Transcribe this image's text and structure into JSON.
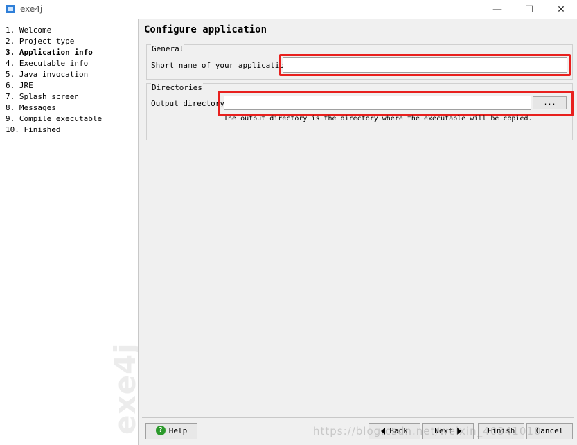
{
  "window": {
    "title": "exe4j",
    "minimize_glyph": "—",
    "maximize_glyph": "☐",
    "close_glyph": "✕"
  },
  "sidebar": {
    "items": [
      {
        "label": "1. Welcome",
        "active": false
      },
      {
        "label": "2. Project type",
        "active": false
      },
      {
        "label": "3. Application info",
        "active": true
      },
      {
        "label": "4. Executable info",
        "active": false
      },
      {
        "label": "5. Java invocation",
        "active": false
      },
      {
        "label": "6. JRE",
        "active": false
      },
      {
        "label": "7. Splash screen",
        "active": false
      },
      {
        "label": "8. Messages",
        "active": false
      },
      {
        "label": "9. Compile executable",
        "active": false
      },
      {
        "label": "10. Finished",
        "active": false
      }
    ],
    "watermark": "exe4j"
  },
  "main": {
    "title": "Configure application",
    "general": {
      "legend": "General",
      "short_name_label": "Short name of your application:",
      "short_name_value": ""
    },
    "directories": {
      "legend": "Directories",
      "output_label": "Output directory:",
      "output_value": "",
      "browse_label": "...",
      "hint": "The output directory is the directory where the executable will be copied."
    }
  },
  "buttons": {
    "help": "Help",
    "back": "Back",
    "next": "Next",
    "finish": "Finish",
    "cancel": "Cancel"
  },
  "overlay_watermark": "https://blog.csdn.net/weixin_40341010",
  "colors": {
    "highlight": "#e8201e",
    "help_icon": "#2c9a2c"
  }
}
